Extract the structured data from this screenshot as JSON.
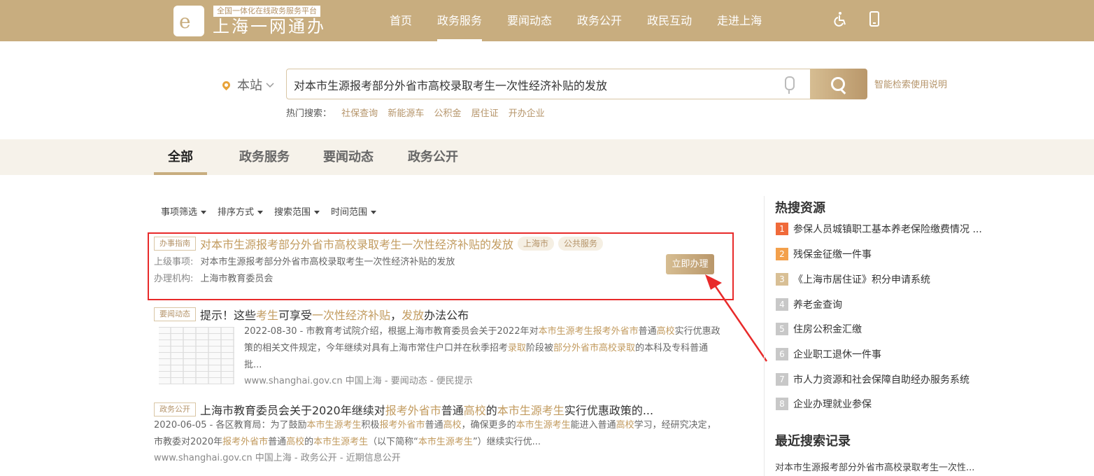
{
  "header": {
    "platform_tag": "全国一体化在线政务服务平台",
    "logo_name": "上海一网通办",
    "logo_letter": "e",
    "nav": [
      {
        "label": "首页",
        "active": false
      },
      {
        "label": "政务服务",
        "active": true
      },
      {
        "label": "要闻动态",
        "active": false
      },
      {
        "label": "政务公开",
        "active": false
      },
      {
        "label": "政民互动",
        "active": false
      },
      {
        "label": "走进上海",
        "active": false
      }
    ],
    "icons": [
      "accessibility-icon",
      "mobile-icon"
    ]
  },
  "search": {
    "scope": "本站",
    "query": "对本市生源报考部分外省市高校录取考生一次性经济补贴的发放",
    "help_link": "智能检索使用说明",
    "hot_label": "热门搜索：",
    "hot_terms": [
      "社保查询",
      "新能源车",
      "公积金",
      "居住证",
      "开办企业"
    ]
  },
  "tabs": [
    "全部",
    "政务服务",
    "要闻动态",
    "政务公开"
  ],
  "active_tab": "全部",
  "filters": [
    "事项筛选",
    "排序方式",
    "搜索范围",
    "时间范围"
  ],
  "results": {
    "r1": {
      "tag": "办事指南",
      "title": "对本市生源报考部分外省市高校录取考生一次性经济补贴的发放",
      "chips": [
        "上海市",
        "公共服务"
      ],
      "parent_label": "上级事项:",
      "parent_value": "对本市生源报考部分外省市高校录取考生一次性经济补贴的发放",
      "org_label": "办理机构:",
      "org_value": "上海市教育委员会",
      "apply_label": "立即办理"
    },
    "r2": {
      "tag": "要闻动态",
      "title_parts": [
        "提示！这些",
        "考生",
        "可享受",
        "一次性经济补贴",
        "，",
        "发放",
        "办法公布"
      ],
      "summary_parts": [
        "2022-08-30 - 市教育考试院介绍，根据上海市教育委员会关于2022年对",
        "本市生源考生报考外省市",
        "普通",
        "高校",
        "实行优惠政策的相关文件规定，今年继续对具有上海市常住户口并在秋季招考",
        "录取",
        "阶段被",
        "部分外省市高校录取",
        "的本科及专科普通批..."
      ],
      "source": "www.shanghai.gov.cn  中国上海 - 要闻动态 - 便民提示"
    },
    "r3": {
      "tag": "政务公开",
      "title_parts": [
        "上海市教育委员会关于2020年继续对",
        "报考外省市",
        "普通",
        "高校",
        "的",
        "本市生源考生",
        "实行优惠政策的..."
      ],
      "summary_parts": [
        "2020-06-05 - 各区教育局：为了鼓励",
        "本市生源考生",
        "积极",
        "报考外省市",
        "普通",
        "高校",
        "，确保更多的",
        "本市生源考生",
        "能进入普通",
        "高校",
        "学习，经研究决定，市教委对2020年",
        "报考外省市",
        "普通",
        "高校",
        "的",
        "本市生源考生",
        "（以下简称“",
        "本市生源考生",
        "”）继续实行优..."
      ],
      "source": "www.shanghai.gov.cn  中国上海 - 政务公开 - 近期信息公开"
    }
  },
  "sidebar": {
    "hot_title": "热搜资源",
    "hot_items": [
      {
        "num": "1",
        "label": "参保人员城镇职工基本养老保险缴费情况 ...",
        "color": "#f06a3a"
      },
      {
        "num": "2",
        "label": "残保金征缴一件事",
        "color": "#f3a04b"
      },
      {
        "num": "3",
        "label": "《上海市居住证》积分申请系统",
        "color": "#d8bf95"
      },
      {
        "num": "4",
        "label": "养老金查询",
        "color": "#c8c8c8"
      },
      {
        "num": "5",
        "label": "住房公积金汇缴",
        "color": "#c8c8c8"
      },
      {
        "num": "6",
        "label": "企业职工退休一件事",
        "color": "#c8c8c8"
      },
      {
        "num": "7",
        "label": "市人力资源和社会保障自助经办服务系统",
        "color": "#c8c8c8"
      },
      {
        "num": "8",
        "label": "企业办理就业参保",
        "color": "#c8c8c8"
      }
    ],
    "recent_title": "最近搜索记录",
    "recent_items": [
      "对本市生源报考部分外省市高校录取考生一次性..."
    ]
  },
  "colors": {
    "brand": "#c8ad7f",
    "highlight": "#c29b5f",
    "annotation": "#e82a2a"
  }
}
